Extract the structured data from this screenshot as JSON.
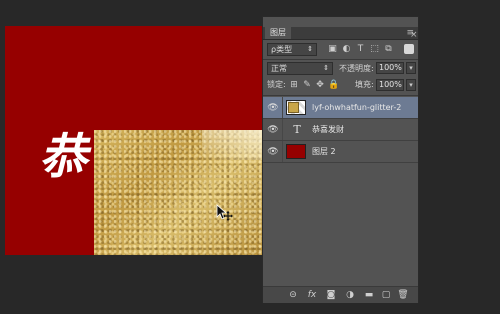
{
  "canvas": {
    "artwork_text": "恭喜发财",
    "colors": {
      "background": "#960000",
      "glitter": "#c9a64a",
      "text": "#ffffff"
    }
  },
  "panel": {
    "tab_label": "图层",
    "collapse_arrows": "«",
    "close_glyph": "×",
    "menu_glyph": "≡",
    "filter": {
      "kind_label": "ρ类型",
      "icons": [
        "image-filter-icon",
        "adjustment-filter-icon",
        "type-filter-icon",
        "shape-filter-icon",
        "smart-object-filter-icon"
      ],
      "icon_glyphs": [
        "▣",
        "◐",
        "T",
        "⬚",
        "⧉"
      ]
    },
    "blend": {
      "mode": "正常",
      "opacity_label": "不透明度:",
      "opacity_value": "100%"
    },
    "lock": {
      "label": "锁定:",
      "icon_glyphs": [
        "⊞",
        "✎",
        "✥",
        "🔒"
      ],
      "fill_label": "填充:",
      "fill_value": "100%"
    },
    "layers": [
      {
        "name": "lyf-ohwhatfun-glitter-2",
        "kind": "smart-object",
        "selected": true
      },
      {
        "name": "恭喜发财",
        "kind": "text",
        "selected": false
      },
      {
        "name": "图层 2",
        "kind": "fill",
        "selected": false
      }
    ],
    "footer_glyphs": [
      "⊝",
      "fx",
      "◙",
      "◑",
      "▬",
      "▢",
      "🗑"
    ],
    "footer_icons": [
      "link-layers-icon",
      "fx-icon",
      "layer-mask-icon",
      "adjustment-layer-icon",
      "group-icon",
      "new-layer-icon",
      "trash-icon"
    ]
  }
}
